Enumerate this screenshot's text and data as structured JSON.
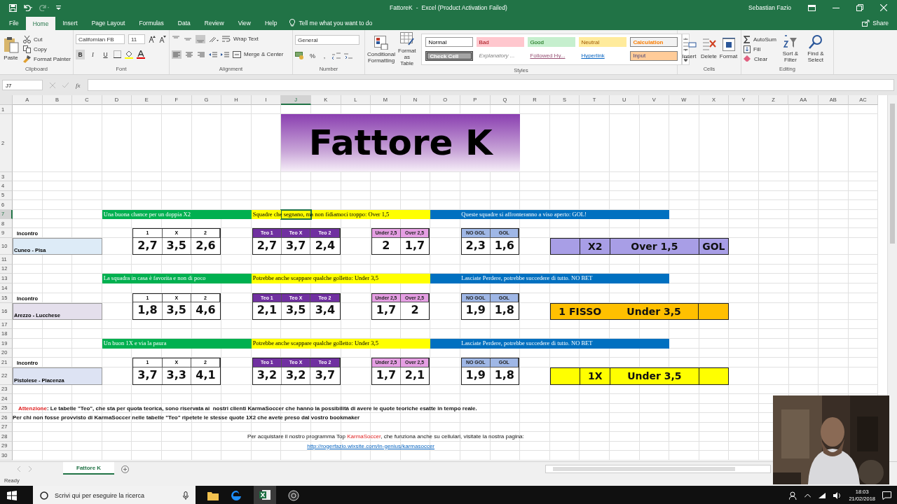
{
  "title_bar": {
    "document": "FattoreK",
    "separator": "-",
    "app": "Excel (Product Activation Failed)",
    "user": "Sebastian Fazio"
  },
  "ribbon_tabs": [
    {
      "label": "File",
      "selected": false
    },
    {
      "label": "Home",
      "selected": true
    },
    {
      "label": "Insert",
      "selected": false
    },
    {
      "label": "Page Layout",
      "selected": false
    },
    {
      "label": "Formulas",
      "selected": false
    },
    {
      "label": "Data",
      "selected": false
    },
    {
      "label": "Review",
      "selected": false
    },
    {
      "label": "View",
      "selected": false
    },
    {
      "label": "Help",
      "selected": false
    }
  ],
  "tell_me": "Tell me what you want to do",
  "share": "Share",
  "clipboard": {
    "label": "Clipboard",
    "paste": "Paste",
    "cut": "Cut",
    "copy": "Copy",
    "format_painter": "Format Painter"
  },
  "font": {
    "label": "Font",
    "name": "Californian FB",
    "size": "11",
    "bold": "B",
    "italic": "I",
    "underline": "U"
  },
  "alignment": {
    "label": "Alignment",
    "wrap_text": "Wrap Text",
    "merge_center": "Merge & Center"
  },
  "number": {
    "label": "Number",
    "format": "General",
    "percent": "%",
    "comma": ","
  },
  "styles": {
    "label": "Styles",
    "conditional": "Conditional Formatting",
    "format_table": "Format as Table",
    "cell_styles": [
      {
        "kind": "normal",
        "label": "Normal"
      },
      {
        "kind": "bad",
        "label": "Bad"
      },
      {
        "kind": "good",
        "label": "Good"
      },
      {
        "kind": "neutral",
        "label": "Neutral"
      },
      {
        "kind": "calculation",
        "label": "Calculation"
      },
      {
        "kind": "check",
        "label": "Check Cell"
      },
      {
        "kind": "explanatory",
        "label": "Explanatory ..."
      },
      {
        "kind": "followed",
        "label": "Followed Hy..."
      },
      {
        "kind": "hyperlink",
        "label": "Hyperlink"
      },
      {
        "kind": "input",
        "label": "Input"
      }
    ]
  },
  "cells": {
    "label": "Cells",
    "insert": "Insert",
    "delete": "Delete",
    "format": "Format"
  },
  "editing": {
    "label": "Editing",
    "autosum": "AutoSum",
    "fill": "Fill",
    "clear": "Clear",
    "sort": "Sort & Filter",
    "find": "Find & Select"
  },
  "formula_bar": {
    "name_box": "J7",
    "fx": "fx"
  },
  "columns": [
    {
      "label": "A",
      "selected": false
    },
    {
      "label": "B",
      "selected": false
    },
    {
      "label": "C",
      "selected": false
    },
    {
      "label": "D",
      "selected": false
    },
    {
      "label": "E",
      "selected": false
    },
    {
      "label": "F",
      "selected": false
    },
    {
      "label": "G",
      "selected": false
    },
    {
      "label": "H",
      "selected": false
    },
    {
      "label": "I",
      "selected": false
    },
    {
      "label": "J",
      "selected": true
    },
    {
      "label": "K",
      "selected": false
    },
    {
      "label": "L",
      "selected": false
    },
    {
      "label": "M",
      "selected": false
    },
    {
      "label": "N",
      "selected": false
    },
    {
      "label": "O",
      "selected": false
    },
    {
      "label": "P",
      "selected": false
    },
    {
      "label": "Q",
      "selected": false
    },
    {
      "label": "R",
      "selected": false
    },
    {
      "label": "S",
      "selected": false
    },
    {
      "label": "T",
      "selected": false
    },
    {
      "label": "U",
      "selected": false
    },
    {
      "label": "V",
      "selected": false
    },
    {
      "label": "W",
      "selected": false
    },
    {
      "label": "X",
      "selected": false
    },
    {
      "label": "Y",
      "selected": false
    },
    {
      "label": "Z",
      "selected": false
    },
    {
      "label": "AA",
      "selected": false
    },
    {
      "label": "AB",
      "selected": false
    },
    {
      "label": "AC",
      "selected": false
    }
  ],
  "rows": [
    {
      "label": "1",
      "selected": false
    },
    {
      "label": "2",
      "selected": false
    },
    {
      "label": "3",
      "selected": false
    },
    {
      "label": "4",
      "selected": false
    },
    {
      "label": "5",
      "selected": false
    },
    {
      "label": "6",
      "selected": false
    },
    {
      "label": "7",
      "selected": true
    },
    {
      "label": "8",
      "selected": false
    },
    {
      "label": "9",
      "selected": false
    },
    {
      "label": "10",
      "selected": false
    },
    {
      "label": "11",
      "selected": false
    },
    {
      "label": "12",
      "selected": false
    },
    {
      "label": "13",
      "selected": false
    },
    {
      "label": "14",
      "selected": false
    },
    {
      "label": "15",
      "selected": false
    },
    {
      "label": "16",
      "selected": false
    },
    {
      "label": "17",
      "selected": false
    },
    {
      "label": "18",
      "selected": false
    },
    {
      "label": "19",
      "selected": false
    },
    {
      "label": "20",
      "selected": false
    },
    {
      "label": "21",
      "selected": false
    },
    {
      "label": "22",
      "selected": false
    },
    {
      "label": "23",
      "selected": false
    },
    {
      "label": "24",
      "selected": false
    },
    {
      "label": "25",
      "selected": false
    },
    {
      "label": "26",
      "selected": false
    },
    {
      "label": "27",
      "selected": false
    },
    {
      "label": "28",
      "selected": false
    },
    {
      "label": "29",
      "selected": false
    },
    {
      "label": "30",
      "selected": false
    }
  ],
  "sheet": {
    "title": "Fattore K",
    "matches": [
      {
        "heading": "Incontro",
        "match": "Cuneo - Pisa",
        "color": "#ddebf7",
        "comments": [
          {
            "text": "Una buona chance per un doppia X2",
            "color": "#00b050"
          },
          {
            "text": "Squadre che segnano, ma non fidiamoci troppo: Over 1,5",
            "color": "#ffff00"
          },
          {
            "text": "Queste squadre si affronteranno a viso aperto: GOL!",
            "color": "#0070c0"
          }
        ],
        "tables": [
          {
            "kind": "result",
            "headers": [
              "1",
              "X",
              "2"
            ],
            "values": [
              "2,7",
              "3,5",
              "2,6"
            ]
          },
          {
            "kind": "teo",
            "headers": [
              "Teo 1",
              "Teo X",
              "Teo 2"
            ],
            "values": [
              "2,7",
              "3,7",
              "2,4"
            ]
          },
          {
            "kind": "under_over",
            "headers": [
              "Under 2,5",
              "Over 2,5"
            ],
            "values": [
              "2",
              "1,7"
            ]
          },
          {
            "kind": "gol",
            "headers": [
              "NO GOL",
              "GOL"
            ],
            "values": [
              "2,3",
              "1,6"
            ]
          }
        ],
        "verdict": {
          "kind": "grid",
          "color": "#a89ee6",
          "texts": [
            "X2",
            "Over 1,5",
            "GOL"
          ]
        }
      },
      {
        "heading": "Incontro",
        "match": "Arezzo - Lucchese",
        "color": "#e4dfec",
        "comments": [
          {
            "text": "La squadra in casa è favorita e non di poco",
            "color": "#00b050"
          },
          {
            "text": "Potrebbe anche scappare qualche golletto: Under 3,5",
            "color": "#ffff00"
          },
          {
            "text": "Lasciate Perdere, potrebbe succedere di tutto. NO BET",
            "color": "#0070c0"
          }
        ],
        "tables": [
          {
            "kind": "result",
            "headers": [
              "1",
              "X",
              "2"
            ],
            "values": [
              "1,8",
              "3,5",
              "4,6"
            ]
          },
          {
            "kind": "teo",
            "headers": [
              "Teo 1",
              "Teo X",
              "Teo 2"
            ],
            "values": [
              "2,1",
              "3,5",
              "3,4"
            ]
          },
          {
            "kind": "under_over",
            "headers": [
              "Under 2,5",
              "Over 2,5"
            ],
            "values": [
              "1,7",
              "2"
            ]
          },
          {
            "kind": "gol",
            "headers": [
              "NO GOL",
              "GOL"
            ],
            "values": [
              "1,9",
              "1,8"
            ]
          }
        ],
        "verdict": {
          "kind": "banner",
          "color": "#ffc000",
          "texts": [
            "1 FISSO",
            "Under 3,5"
          ]
        }
      },
      {
        "heading": "Incontro",
        "match": "Pistolese - Placenza",
        "color": "#dde3f3",
        "comments": [
          {
            "text": "Un buon 1X e via la paura",
            "color": "#00b050"
          },
          {
            "text": "Potrebbe anche scappare qualche golletto: Under 3,5",
            "color": "#ffff00"
          },
          {
            "text": "Lasciate Perdere, potrebbe succedere di tutto. NO BET",
            "color": "#0070c0"
          }
        ],
        "tables": [
          {
            "kind": "result",
            "headers": [
              "1",
              "X",
              "2"
            ],
            "values": [
              "3,7",
              "3,3",
              "4,1"
            ]
          },
          {
            "kind": "teo",
            "headers": [
              "Teo 1",
              "Teo X",
              "Teo 2"
            ],
            "values": [
              "3,2",
              "3,2",
              "3,7"
            ]
          },
          {
            "kind": "under_over",
            "headers": [
              "Under 2,5",
              "Over 2,5"
            ],
            "values": [
              "1,7",
              "2,1"
            ]
          },
          {
            "kind": "gol",
            "headers": [
              "NO GOL",
              "GOL"
            ],
            "values": [
              "1,9",
              "1,8"
            ]
          }
        ],
        "verdict": {
          "kind": "grid",
          "color": "#ffff00",
          "texts": [
            "1X",
            "Under 3,5"
          ]
        }
      }
    ],
    "notes": [
      {
        "bold": true,
        "centered": false,
        "parts": [
          {
            "text": "Attenzione",
            "emphasis": true
          },
          {
            "text": ": Le tabelle \"Teo\", che sta per quota teorica, sono riservata ai  nostri clienti KarmaSoccer che hanno la possibilità di avere le quote teoriche esatte in tempo reale.",
            "emphasis": false
          }
        ]
      },
      {
        "bold": true,
        "centered": false,
        "parts": [
          {
            "text": "Per chi non fosse provvisto di KarmaSoccer nelle tabelle \"Teo\" ripetete le stesse quote 1X2 che avete preso dal vostro bookmaker",
            "emphasis": false
          }
        ]
      },
      {
        "bold": false,
        "centered": true,
        "parts": [
          {
            "text": "Per acquistare il nostro programma Top ",
            "emphasis": false
          },
          {
            "text": "KarmaSoccer",
            "emphasis": true
          },
          {
            "text": ", che funziona anche su cellulari, visitate la nostra pagina:",
            "emphasis": false
          }
        ]
      }
    ],
    "link": "http://rogerfazio.wixsite.com/in-genius/karmasoccer"
  },
  "sheet_tabs": [
    {
      "label": "Fattore K",
      "selected": true
    }
  ],
  "status": "Ready",
  "taskbar": {
    "search": "Scrivi qui per eseguire la ricerca",
    "time": "18:03",
    "date": "21/02/2018"
  }
}
